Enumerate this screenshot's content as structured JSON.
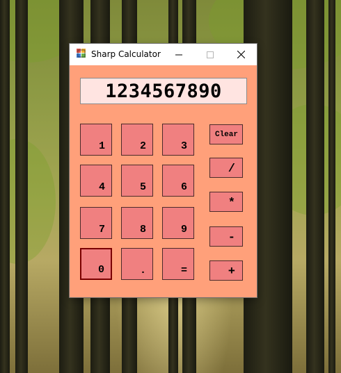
{
  "window": {
    "title": "Sharp Calculator",
    "controls": {
      "minimize": "—",
      "maximize": "☐",
      "close": "✕"
    }
  },
  "display": {
    "value": "1234567890"
  },
  "keys": {
    "k1": "1",
    "k2": "2",
    "k3": "3",
    "k4": "4",
    "k5": "5",
    "k6": "6",
    "k7": "7",
    "k8": "8",
    "k9": "9",
    "k0": "0",
    "dot": ".",
    "equals": "="
  },
  "ops": {
    "clear": "Clear",
    "divide": "/",
    "multiply": "*",
    "subtract": "-",
    "add": "+"
  },
  "colors": {
    "form_bg": "#ffa07a",
    "button_bg": "#f08080",
    "display_bg": "#ffe4e1"
  }
}
